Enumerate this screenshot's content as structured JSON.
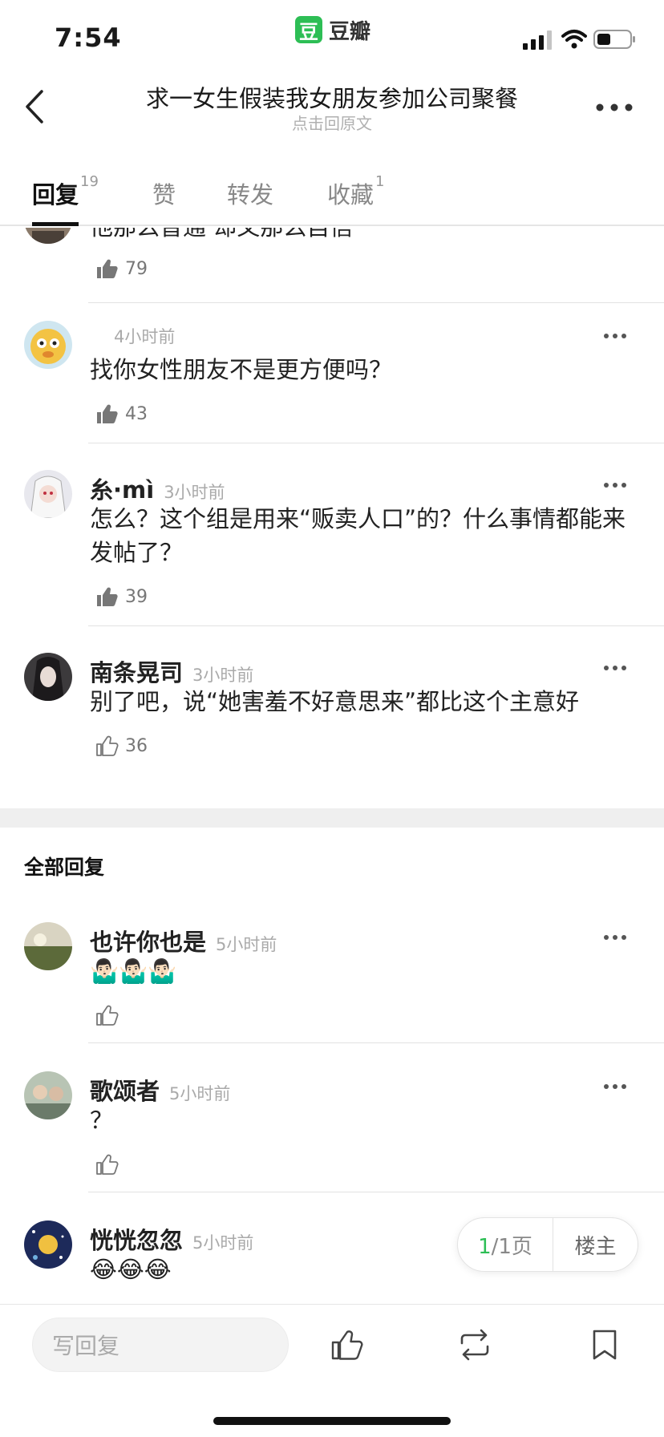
{
  "status_bar": {
    "time": "7:54",
    "brand": "豆瓣",
    "brand_logo_char": "豆"
  },
  "header": {
    "title": "求一女生假装我女朋友参加公司聚餐",
    "subtitle": "点击回原文"
  },
  "tabs": [
    {
      "label": "回复",
      "count": "19",
      "active": true
    },
    {
      "label": "赞",
      "count": ""
    },
    {
      "label": "转发",
      "count": ""
    },
    {
      "label": "收藏",
      "count": "1"
    }
  ],
  "top_comments": [
    {
      "name": "",
      "time": "",
      "text": "他那么普通 却又那么自信",
      "likes": "79"
    },
    {
      "name": "",
      "time": "4小时前",
      "text": "找你女性朋友不是更方便吗？",
      "likes": "43"
    },
    {
      "name": "糸·mì",
      "time": "3小时前",
      "text": "怎么？这个组是用来“贩卖人口”的？什么事情都能来发帖了？",
      "likes": "39"
    },
    {
      "name": "南条晃司",
      "time": "3小时前",
      "text": "别了吧，说“她害羞不好意思来”都比这个主意好",
      "likes": "36"
    }
  ],
  "section_title": "全部回复",
  "all_comments": [
    {
      "name": "也许你也是",
      "time": "5小时前",
      "text": "🤷🏻‍♂️🤷🏻‍♂️🤷🏻‍♂️",
      "likes": ""
    },
    {
      "name": "歌颂者",
      "time": "5小时前",
      "text": "？",
      "likes": ""
    },
    {
      "name": "恍恍忽忽",
      "time": "5小时前",
      "text": "😂😂😂",
      "likes": ""
    }
  ],
  "pager": {
    "current": "1",
    "total_label": "/1页",
    "op_label": "楼主"
  },
  "bottom_bar": {
    "reply_placeholder": "写回复"
  },
  "colors": {
    "accent": "#2dbe55",
    "text": "#222222",
    "muted": "#aaaaaa",
    "divider": "#e2e2e2"
  }
}
